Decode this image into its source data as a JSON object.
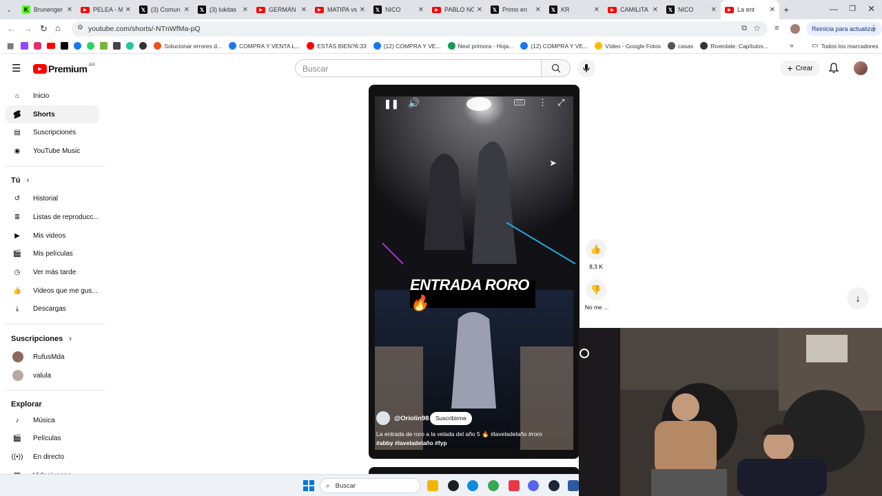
{
  "browser": {
    "tabs": [
      {
        "label": "Brunenger",
        "fav": "k"
      },
      {
        "label": "PELEA - M",
        "fav": "yt"
      },
      {
        "label": "(3) Comun",
        "fav": "x"
      },
      {
        "label": "(3) lukitas",
        "fav": "x"
      },
      {
        "label": "GERMÁN",
        "fav": "yt"
      },
      {
        "label": "MATIPA vs",
        "fav": "yt"
      },
      {
        "label": "NICO",
        "fav": "x"
      },
      {
        "label": "PABLO NO",
        "fav": "yt"
      },
      {
        "label": "Primo en",
        "fav": "x"
      },
      {
        "label": "KR",
        "fav": "x"
      },
      {
        "label": "CAMILITA",
        "fav": "yt"
      },
      {
        "label": "NICO",
        "fav": "x"
      },
      {
        "label": "La ent",
        "fav": "yt",
        "active": true
      }
    ],
    "url": "youtube.com/shorts/-NTnWfMa-pQ",
    "update_button": "Reinicia para actualizar",
    "bookmarks": [
      {
        "label": "Solucionar errores d...",
        "color": "#f25022"
      },
      {
        "label": "COMPRA Y VENTA L...",
        "color": "#1877f2"
      },
      {
        "label": "ESTÁS BIEN?6:33",
        "color": "#ff0000"
      },
      {
        "label": "(12) COMPRA Y VE...",
        "color": "#1877f2"
      },
      {
        "label": "Next primora - Hoja...",
        "color": "#0f9d58"
      },
      {
        "label": "(12) COMPRA Y VE...",
        "color": "#1877f2"
      },
      {
        "label": "Vídeo - Google Fotos",
        "color": "#fbbc04"
      },
      {
        "label": "casas",
        "color": "#555"
      },
      {
        "label": "Riverdale: Capítulos...",
        "color": "#333"
      }
    ],
    "all_bookmarks": "Todos los marcadores"
  },
  "youtube": {
    "logo_text": "Premium",
    "logo_region": "AR",
    "search_placeholder": "Buscar",
    "create_label": "Crear",
    "sidebar": {
      "main": [
        "Inicio",
        "Shorts",
        "Suscripciones",
        "YouTube Music"
      ],
      "you_heading": "Tú",
      "you_items": [
        "Historial",
        "Listas de reproducc...",
        "Mis videos",
        "Mis películas",
        "Ver más tarde",
        "Videos que me gus...",
        "Descargas"
      ],
      "subs_heading": "Suscripciones",
      "subs": [
        "RufusMda",
        "valula"
      ],
      "explore_heading": "Explorar",
      "explore_items": [
        "Música",
        "Películas",
        "En directo",
        "Videojuegos"
      ]
    },
    "short": {
      "overlay_title": "ENTRADA RORO🔥",
      "channel": "@Oriolin98",
      "subscribe": "Suscribirme",
      "description_line1": "La entrada de roro a la velada del año 5 🔥 #laveladelaño #roro",
      "description_line2": "#abby #laveladelaño #fyp",
      "likes": "8,3 K",
      "dislike_label": "No me ..."
    }
  },
  "taskbar": {
    "search_label": "Buscar"
  }
}
